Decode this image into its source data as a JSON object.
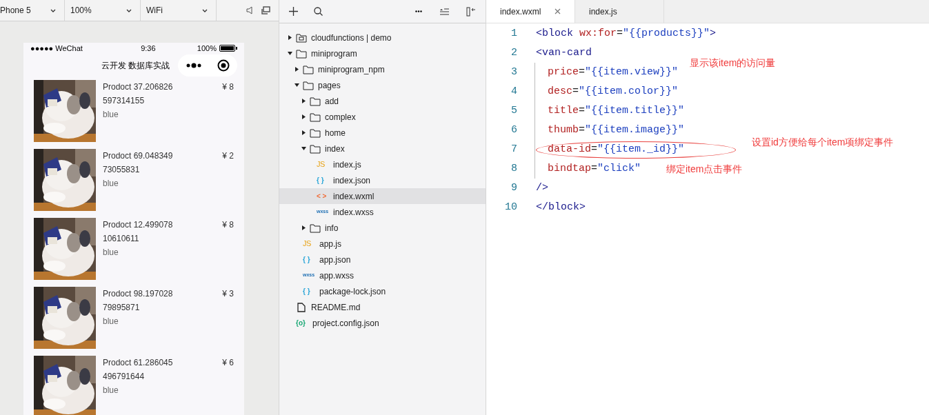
{
  "simulator_toolbar": {
    "device": "Phone 5",
    "zoom": "100%",
    "network": "WiFi"
  },
  "phone": {
    "status_bar": {
      "carrier": "●●●●● WeChat",
      "time": "9:36",
      "battery": "100%"
    },
    "nav_title": "云开发 数据库实战",
    "products": [
      {
        "title": "Prodoct 37.206826597314155",
        "price": "¥ 8",
        "desc": "blue"
      },
      {
        "title": "Prodoct 69.04834973055831",
        "price": "¥ 2",
        "desc": "blue"
      },
      {
        "title": "Prodoct 12.49907810610611",
        "price": "¥ 8",
        "desc": "blue"
      },
      {
        "title": "Prodoct 98.19702879895871",
        "price": "¥ 3",
        "desc": "blue"
      },
      {
        "title": "Prodoct 61.286045496791644",
        "price": "¥ 6",
        "desc": "blue"
      }
    ]
  },
  "explorer": {
    "tree": [
      {
        "label": "cloudfunctions | demo",
        "kind": "cloud",
        "expanded": false,
        "selected": false
      },
      {
        "label": "miniprogram",
        "kind": "folder",
        "expanded": true,
        "selected": false,
        "children": [
          {
            "label": "miniprogram_npm",
            "kind": "folder",
            "expanded": false,
            "selected": false
          },
          {
            "label": "pages",
            "kind": "folder",
            "expanded": true,
            "selected": false,
            "children": [
              {
                "label": "add",
                "kind": "folder",
                "expanded": false,
                "selected": false
              },
              {
                "label": "complex",
                "kind": "folder",
                "expanded": false,
                "selected": false
              },
              {
                "label": "home",
                "kind": "folder",
                "expanded": false,
                "selected": false
              },
              {
                "label": "index",
                "kind": "folder",
                "expanded": true,
                "selected": false,
                "children": [
                  {
                    "label": "index.js",
                    "kind": "js",
                    "icon": "JS",
                    "selected": false
                  },
                  {
                    "label": "index.json",
                    "kind": "json",
                    "icon": "{ }",
                    "selected": false
                  },
                  {
                    "label": "index.wxml",
                    "kind": "wxml",
                    "icon": "< >",
                    "selected": true
                  },
                  {
                    "label": "index.wxss",
                    "kind": "wxss",
                    "icon": "wxss",
                    "selected": false
                  }
                ]
              },
              {
                "label": "info",
                "kind": "folder",
                "expanded": false,
                "selected": false
              }
            ]
          },
          {
            "label": "app.js",
            "kind": "js",
            "icon": "JS",
            "selected": false
          },
          {
            "label": "app.json",
            "kind": "json",
            "icon": "{ }",
            "selected": false
          },
          {
            "label": "app.wxss",
            "kind": "wxss",
            "icon": "wxss",
            "selected": false
          },
          {
            "label": "package-lock.json",
            "kind": "json",
            "icon": "{ }",
            "selected": false
          }
        ]
      },
      {
        "label": "README.md",
        "kind": "file",
        "selected": false
      },
      {
        "label": "project.config.json",
        "kind": "config",
        "icon": "{o}",
        "selected": false
      }
    ]
  },
  "editor": {
    "tabs": [
      {
        "label": "index.wxml",
        "selected": true
      },
      {
        "label": "index.js",
        "selected": false
      }
    ],
    "lines": [
      {
        "number": "1",
        "indent": false,
        "tokens": [
          {
            "kind": "tag",
            "text": "<block"
          },
          {
            "kind": "attr",
            "text": "wx:for"
          },
          {
            "kind": "punct",
            "text": "="
          },
          {
            "kind": "string",
            "text": "\"{{products}}\""
          },
          {
            "kind": "tag",
            "text": ">"
          }
        ]
      },
      {
        "number": "2",
        "indent": false,
        "tokens": [
          {
            "kind": "tag",
            "text": "<van-card"
          }
        ]
      },
      {
        "number": "3",
        "indent": true,
        "tokens": [
          {
            "kind": "attr",
            "text": "price"
          },
          {
            "kind": "punct",
            "text": "="
          },
          {
            "kind": "string",
            "text": "\"{{item.view}}\""
          }
        ]
      },
      {
        "number": "4",
        "indent": true,
        "tokens": [
          {
            "kind": "attr",
            "text": "desc"
          },
          {
            "kind": "punct",
            "text": "="
          },
          {
            "kind": "string",
            "text": "\"{{item.color}}\""
          }
        ]
      },
      {
        "number": "5",
        "indent": true,
        "tokens": [
          {
            "kind": "attr",
            "text": "title"
          },
          {
            "kind": "punct",
            "text": "="
          },
          {
            "kind": "string",
            "text": "\"{{item.title}}\""
          }
        ]
      },
      {
        "number": "6",
        "indent": true,
        "tokens": [
          {
            "kind": "attr",
            "text": "thumb"
          },
          {
            "kind": "punct",
            "text": "="
          },
          {
            "kind": "string",
            "text": "\"{{item.image}}\""
          }
        ]
      },
      {
        "number": "7",
        "indent": true,
        "circled": true,
        "tokens": [
          {
            "kind": "attr",
            "text": "data-id"
          },
          {
            "kind": "punct",
            "text": "="
          },
          {
            "kind": "string",
            "text": "\"{{item._id}}\""
          }
        ]
      },
      {
        "number": "8",
        "indent": true,
        "tokens": [
          {
            "kind": "attr",
            "text": "bindtap"
          },
          {
            "kind": "punct",
            "text": "="
          },
          {
            "kind": "string",
            "text": "\"click\""
          }
        ]
      },
      {
        "number": "9",
        "indent": false,
        "tokens": [
          {
            "kind": "tag",
            "text": "/>"
          }
        ]
      },
      {
        "number": "10",
        "indent": false,
        "tokens": [
          {
            "kind": "tag",
            "text": "</block>"
          }
        ]
      }
    ],
    "annotations": [
      {
        "text": "显示该item的访问量"
      },
      {
        "text": "设置id方便给每个item项绑定事件"
      },
      {
        "text": "绑定item点击事件"
      }
    ]
  }
}
